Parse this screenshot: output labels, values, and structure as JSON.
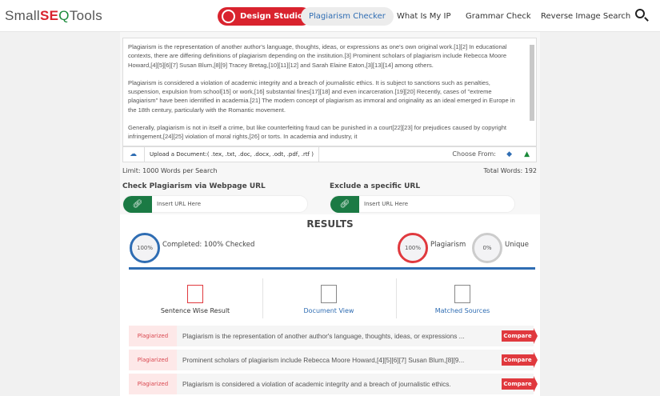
{
  "header": {
    "logo_a": "Small",
    "logo_b": "SE",
    "logo_c": "Q",
    "logo_d": "Tools",
    "nav": [
      "Design Studio",
      "Plagiarism Checker",
      "What Is My IP",
      "Grammar Check",
      "Reverse Image Search"
    ]
  },
  "editor": {
    "paragraphs": [
      "Plagiarism is the representation of another author's language, thoughts, ideas, or expressions as one's own original work.[1][2] In educational contexts, there are differing definitions of plagiarism depending on the institution.[3] Prominent scholars of plagiarism include Rebecca Moore Howard,[4][5][6][7] Susan Blum,[8][9] Tracey Bretag,[10][11][12] and Sarah Elaine Eaton,[3][13][14] among others.",
      "Plagiarism is considered a violation of academic integrity and a breach of journalistic ethics. It is subject to sanctions such as penalties, suspension, expulsion from school[15] or work,[16] substantial fines[17][18] and even incarceration.[19][20] Recently, cases of \"extreme plagiarism\" have been identified in academia.[21] The modern concept of plagiarism as immoral and originality as an ideal emerged in Europe in the 18th century, particularly with the Romantic movement.",
      "Generally, plagiarism is not in itself a crime, but like counterfeiting fraud can be punished in a court[22][23] for prejudices caused by copyright infringement,[24][25] violation of moral rights,[26] or torts. In academia and industry, it"
    ],
    "upload_label": "Upload a Document:( .tex, .txt, .doc, .docx, .odt, .pdf, .rtf )",
    "choose_from": "Choose From:",
    "limit": "Limit: 1000 Words per Search",
    "total_words": "Total Words: 192"
  },
  "url": {
    "check_label": "Check Plagiarism via Webpage URL",
    "exclude_label": "Exclude a specific URL",
    "placeholder": "Insert URL Here"
  },
  "results": {
    "title": "RESULTS",
    "completed_pct": "100%",
    "completed_text": "Completed: 100% Checked",
    "plag_pct": "100%",
    "plag_label": "Plagiarism",
    "unique_pct": "0%",
    "unique_label": "Unique",
    "tabs": [
      "Sentence Wise Result",
      "Document View",
      "Matched Sources"
    ],
    "rows": [
      {
        "tag": "Plagiarized",
        "text": "Plagiarism is the representation of another author's language, thoughts, ideas, or expressions ...",
        "btn": "Compare"
      },
      {
        "tag": "Plagiarized",
        "text": "Prominent scholars of plagiarism include Rebecca Moore Howard,[4][5][6][7] Susan Blum,[8][9...",
        "btn": "Compare"
      },
      {
        "tag": "Plagiarized",
        "text": "Plagiarism is considered a violation of academic integrity and a breach of journalistic ethics.",
        "btn": "Compare"
      }
    ]
  },
  "colors": {
    "brand_red": "#d9232e",
    "blue": "#2f6db3",
    "green": "#1b7a44"
  }
}
